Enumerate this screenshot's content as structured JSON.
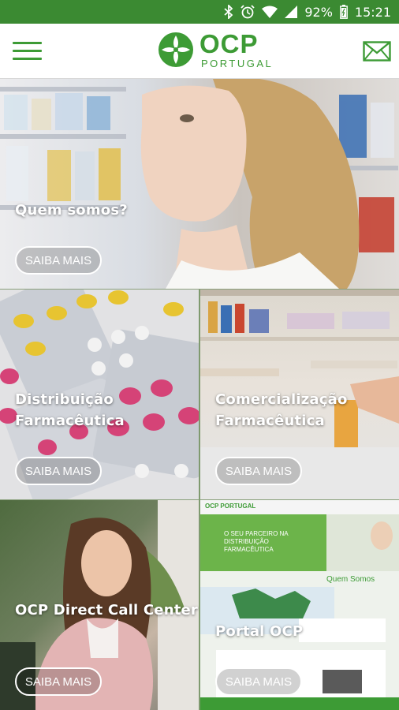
{
  "status_bar": {
    "battery": "92%",
    "time": "15:21",
    "icons": [
      "bluetooth-icon",
      "alarm-icon",
      "wifi-icon",
      "signal-icon",
      "battery-icon"
    ]
  },
  "header": {
    "logo_text": "OCP",
    "logo_subtext": "PORTUGAL",
    "menu_icon": "hamburger-menu-icon",
    "mail_icon": "envelope-icon"
  },
  "colors": {
    "brand_green": "#3d9b35",
    "status_bar_green": "#3b8a32"
  },
  "tiles": [
    {
      "title": "Quem somos?",
      "button": "SAIBA MAIS"
    },
    {
      "title": "Distribuição Farmacêutica",
      "button": "SAIBA MAIS"
    },
    {
      "title": "Comercialização Farmacêutica",
      "button": "SAIBA MAIS"
    },
    {
      "title": "OCP Direct Call Center",
      "button": "SAIBA MAIS"
    },
    {
      "title": "Portal OCP",
      "button": "SAIBA MAIS"
    }
  ],
  "portal_preview": {
    "logo_text": "OCP PORTUGAL",
    "banner_text": "O SEU PARCEIRO NA DISTRIBUIÇÃO FARMACÊUTICA",
    "section_heading": "Quem Somos"
  }
}
